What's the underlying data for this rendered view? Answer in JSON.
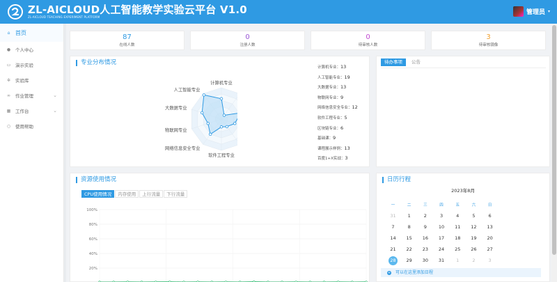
{
  "header": {
    "title": "ZL-AICLOUD人工智能教学实验云平台 V1.0",
    "subtitle": "ZL-AICLOUD TEACHING EXPERIMENT PLATFORM",
    "user_name": "管理员",
    "user_caret": "▾"
  },
  "sidebar": {
    "items": [
      {
        "label": "首页",
        "icon": "home-icon",
        "glyph": "⌂"
      },
      {
        "label": "个人中心",
        "icon": "person-icon",
        "glyph": "●"
      },
      {
        "label": "演示实验",
        "icon": "monitor-icon",
        "glyph": "▭"
      },
      {
        "label": "实验库",
        "icon": "gear-icon",
        "glyph": "✲"
      },
      {
        "label": "作业管理",
        "icon": "link-icon",
        "glyph": "∞"
      },
      {
        "label": "工作台",
        "icon": "grid-icon",
        "glyph": "▦"
      },
      {
        "label": "使用帮助",
        "icon": "search-icon",
        "glyph": "○"
      }
    ],
    "chevron": "⌄"
  },
  "stats": [
    {
      "value": "87",
      "label": "在线人数",
      "color": "#2f9ae3"
    },
    {
      "value": "0",
      "label": "注册人数",
      "color": "#9b59d6"
    },
    {
      "value": "0",
      "label": "待审核人数",
      "color": "#c04bd1"
    },
    {
      "value": "3",
      "label": "待审核镜像",
      "color": "#f0a030"
    }
  ],
  "majors": {
    "title": "专业分布情况",
    "items": [
      {
        "name": "计算机专业",
        "value": 13
      },
      {
        "name": "人工智能专业",
        "value": 19
      },
      {
        "name": "大数据专业",
        "value": 13
      },
      {
        "name": "物联网专业",
        "value": 9
      },
      {
        "name": "网络信息安全专业",
        "value": 12
      },
      {
        "name": "软件工程专业",
        "value": 5
      },
      {
        "name": "区块链专业",
        "value": 6
      },
      {
        "name": "基础课",
        "value": 9
      },
      {
        "name": "课程展示样例",
        "value": 13
      },
      {
        "name": "百度1+X实战",
        "value": 3
      }
    ],
    "radar_order": [
      "计算机专业",
      "百度1+X实战",
      "课程展示样例",
      "基础课",
      "区块链专业",
      "软件工程专业",
      "网络信息安全专业",
      "物联网专业",
      "大数据专业",
      "人工智能专业"
    ],
    "radar_max": 20
  },
  "todo": {
    "tabs": [
      "待办事项",
      "公告"
    ]
  },
  "resources": {
    "title": "资源使用情况",
    "tabs": [
      "CPU使用情况",
      "内存使用",
      "上行流量",
      "下行流量"
    ],
    "y_ticks": [
      "100%",
      "80%",
      "60%",
      "40%",
      "20%"
    ],
    "cpu_series": [
      1,
      1,
      1.2,
      1,
      1.1,
      1.3,
      1,
      1.2,
      1,
      1.1,
      1,
      1.4,
      1,
      1,
      1.1,
      1,
      1,
      1.2,
      1,
      1.1
    ]
  },
  "calendar": {
    "title": "日历行程",
    "month": "2023年8月",
    "weekdays": [
      "一",
      "二",
      "三",
      "四",
      "五",
      "六",
      "日"
    ],
    "weeks": [
      [
        {
          "d": "31",
          "dim": true
        },
        {
          "d": "1"
        },
        {
          "d": "2"
        },
        {
          "d": "3"
        },
        {
          "d": "4"
        },
        {
          "d": "5"
        },
        {
          "d": "6"
        }
      ],
      [
        {
          "d": "7"
        },
        {
          "d": "8"
        },
        {
          "d": "9"
        },
        {
          "d": "10"
        },
        {
          "d": "11"
        },
        {
          "d": "12"
        },
        {
          "d": "13"
        }
      ],
      [
        {
          "d": "14"
        },
        {
          "d": "15"
        },
        {
          "d": "16"
        },
        {
          "d": "17"
        },
        {
          "d": "18"
        },
        {
          "d": "19"
        },
        {
          "d": "20"
        }
      ],
      [
        {
          "d": "21"
        },
        {
          "d": "22"
        },
        {
          "d": "23"
        },
        {
          "d": "24"
        },
        {
          "d": "25"
        },
        {
          "d": "26"
        },
        {
          "d": "27"
        }
      ],
      [
        {
          "d": "28",
          "today": true
        },
        {
          "d": "29"
        },
        {
          "d": "30"
        },
        {
          "d": "31"
        },
        {
          "d": "1",
          "dim": true
        },
        {
          "d": "2",
          "dim": true
        },
        {
          "d": "3",
          "dim": true
        }
      ]
    ],
    "add_label": "可以在这里添加日程"
  },
  "colors": {
    "accent": "#2f9ae3",
    "radar_fill": "#bfe0f6",
    "cpu_line": "#3cbf7a"
  }
}
